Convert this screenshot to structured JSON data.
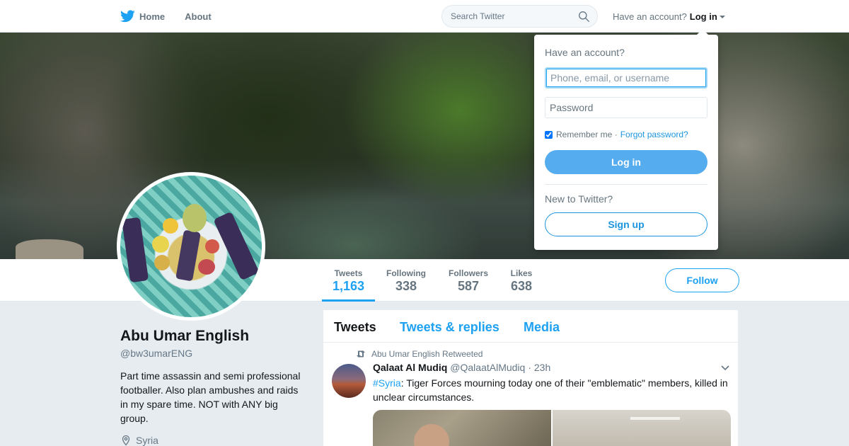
{
  "nav": {
    "home_label": "Home",
    "about_label": "About",
    "search_placeholder": "Search Twitter",
    "have_account": "Have an account?",
    "login_label": "Log in"
  },
  "login_dropdown": {
    "heading": "Have an account?",
    "username_placeholder": "Phone, email, or username",
    "password_placeholder": "Password",
    "remember_label": "Remember me ·",
    "remember_checked": true,
    "forgot_label": "Forgot password?",
    "login_button": "Log in",
    "new_prompt": "New to Twitter?",
    "signup_button": "Sign up"
  },
  "stats": [
    {
      "label": "Tweets",
      "value": "1,163",
      "active": true
    },
    {
      "label": "Following",
      "value": "338",
      "active": false
    },
    {
      "label": "Followers",
      "value": "587",
      "active": false
    },
    {
      "label": "Likes",
      "value": "638",
      "active": false
    }
  ],
  "follow_button": "Follow",
  "profile": {
    "name": "Abu Umar English",
    "handle": "@bw3umarENG",
    "bio": "Part time assassin and semi professional footballer. Also plan ambushes and raids in my spare time. NOT with ANY big group.",
    "location": "Syria"
  },
  "timeline": {
    "tabs": [
      "Tweets",
      "Tweets & replies",
      "Media"
    ],
    "active_tab": "Tweets",
    "tweet": {
      "retweet_note": "Abu Umar English Retweeted",
      "author_name": "Qalaat Al Mudiq",
      "author_handle": "@QalaatAlMudiq",
      "time": "· 23h",
      "hashtag": "#Syria",
      "text": ": Tiger Forces mourning today one of their \"emblematic\" members, killed in unclear circumstances."
    }
  },
  "colors": {
    "accent": "#1da1f2",
    "login_button": "#55acee",
    "background": "#e6ecf0"
  }
}
